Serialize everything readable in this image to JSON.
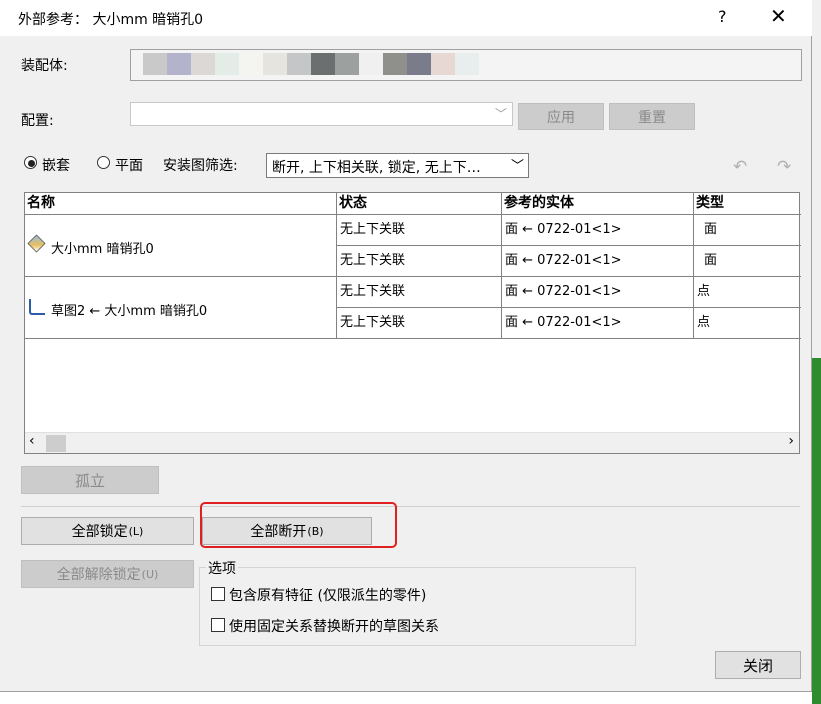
{
  "title": "外部参考： 大小mm 暗销孔0",
  "title_help": "?",
  "title_close": "✕",
  "assembly": {
    "label": "装配体:",
    "swatches": [
      "#c9c9c9",
      "#b3b3cc",
      "#dcd8d6",
      "#e4ece8",
      "#f4f4f0",
      "#e6e4df",
      "#c4c6c8",
      "#6b6f6f",
      "#9ca09e",
      "#f0f0f0",
      "#8f8f8b",
      "#7a7c8c",
      "#e8d8d4",
      "#e8eeee"
    ]
  },
  "config": {
    "label": "配置:",
    "apply": "应用",
    "reset": "重置"
  },
  "view": {
    "nest": "嵌套",
    "flat": "平面",
    "filter_label": "安装图筛选:",
    "filter_value": "断开, 上下相关联, 锁定, 无上下…"
  },
  "table": {
    "headers": [
      "名称",
      "状态",
      "参考的实体",
      "类型"
    ],
    "groups": [
      {
        "name": "大小mm 暗销孔0",
        "rows": [
          {
            "status": "无上下关联",
            "entity": "面 ← 0722-01<1>",
            "type": "面"
          },
          {
            "status": "无上下关联",
            "entity": "面 ← 0722-01<1>",
            "type": "面"
          }
        ]
      },
      {
        "name": "草图2 ← 大小mm 暗销孔0",
        "rows": [
          {
            "status": "无上下关联",
            "entity": "面 ← 0722-01<1>",
            "type": "点"
          },
          {
            "status": "无上下关联",
            "entity": "面 ← 0722-01<1>",
            "type": "点"
          }
        ]
      }
    ]
  },
  "buttons": {
    "isolate": "孤立",
    "lock_all": "全部锁定",
    "lock_all_key": "(L)",
    "break_all": "全部断开",
    "break_all_key": "(B)",
    "unlock_all": "全部解除锁定",
    "unlock_all_key": "(U)",
    "close": "关闭"
  },
  "options": {
    "legend": "选项",
    "opt1": "包含原有特征 (仅限派生的零件)",
    "opt2": "使用固定关系替换断开的草图关系"
  },
  "colors": {
    "highlight": "#e02020",
    "accent_green": "#2e8b2e"
  }
}
